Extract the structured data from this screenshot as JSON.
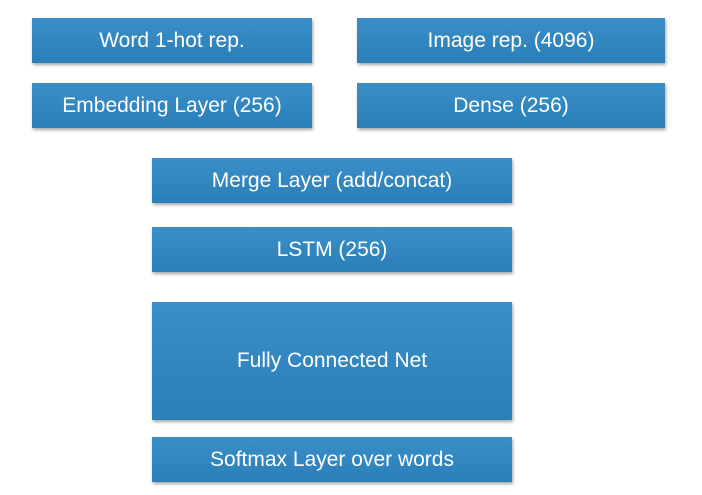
{
  "blocks": {
    "word_input": "Word 1-hot rep.",
    "image_input": "Image rep. (4096)",
    "embedding": "Embedding Layer (256)",
    "dense": "Dense (256)",
    "merge": "Merge Layer (add/concat)",
    "lstm": "LSTM (256)",
    "fully_connected": "Fully Connected Net",
    "softmax": "Softmax Layer over words"
  },
  "colors": {
    "block_fill": "#2e86c1",
    "block_text": "#ffffff",
    "background": "#ffffff"
  }
}
